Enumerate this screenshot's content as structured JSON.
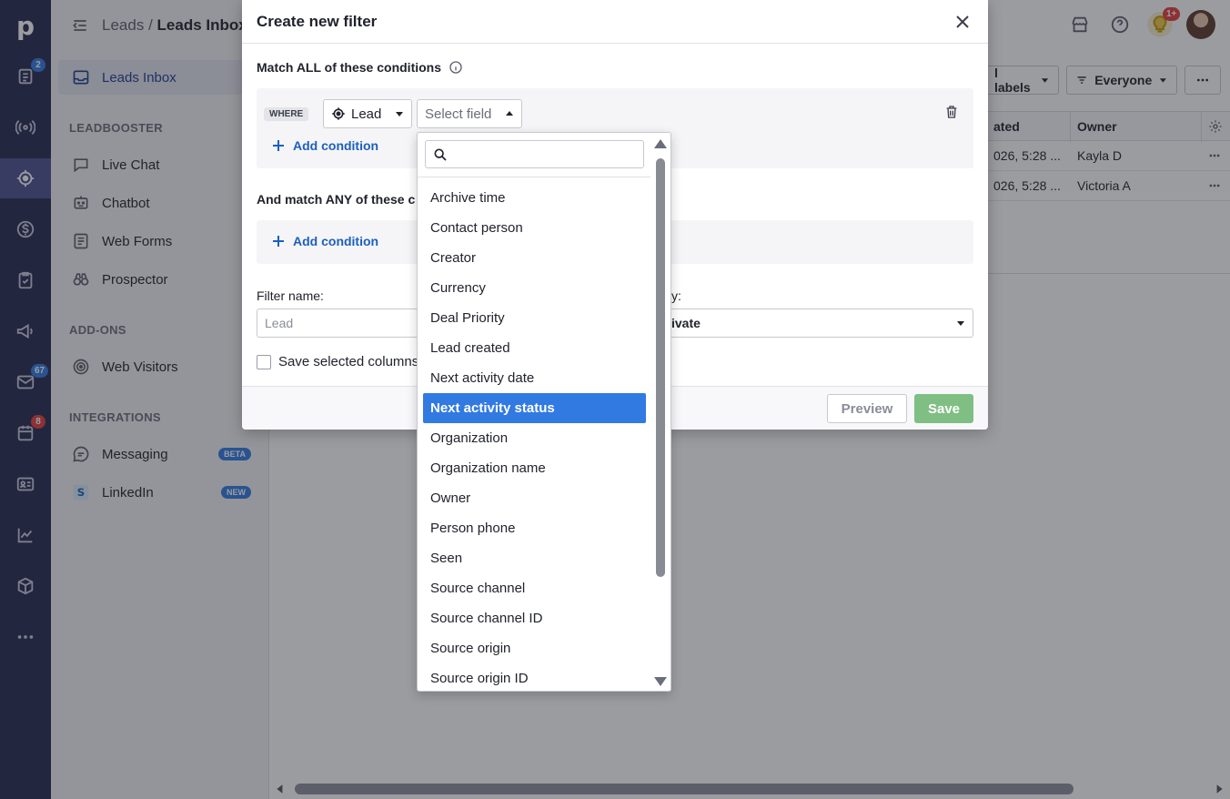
{
  "rail": {
    "logo": "p",
    "badges": {
      "activities": "2",
      "mail": "67",
      "calendar": "8"
    }
  },
  "header": {
    "crumb_parent": "Leads",
    "crumb_sep": "/",
    "crumb_current": "Leads Inbox",
    "notif_badge": "1+"
  },
  "sidenav": {
    "leads_inbox": "Leads Inbox",
    "sections": {
      "leadbooster": "LEADBOOSTER",
      "addons": "ADD-ONS",
      "integrations": "INTEGRATIONS"
    },
    "leadbooster_items": [
      "Live Chat",
      "Chatbot",
      "Web Forms",
      "Prospector"
    ],
    "addon_items": [
      "Web Visitors"
    ],
    "integration_items": [
      {
        "label": "Messaging",
        "pill": "BETA"
      },
      {
        "label": "LinkedIn",
        "pill": "NEW"
      }
    ]
  },
  "toolbar": {
    "labels_filter": "l labels",
    "owner_filter": "Everyone"
  },
  "grid": {
    "columns": [
      "ated",
      "Owner"
    ],
    "rows": [
      {
        "created": "026, 5:28 ...",
        "owner": "Kayla D"
      },
      {
        "created": "026, 5:28 ...",
        "owner": "Victoria A"
      }
    ]
  },
  "modal": {
    "title": "Create new filter",
    "match_all": "Match ALL of these conditions",
    "where": "WHERE",
    "entity": "Lead",
    "field_placeholder": "Select field",
    "add_condition": "Add condition",
    "match_any": "And match ANY of these c",
    "filter_name_label": "Filter name:",
    "filter_name_placeholder": "Lead",
    "visibility_label": "y:",
    "visibility_value": "ivate",
    "save_columns": "Save selected columns",
    "preview": "Preview",
    "save": "Save"
  },
  "dropdown": {
    "search_placeholder": "",
    "selected_index": 7,
    "items": [
      "Archive time",
      "Contact person",
      "Creator",
      "Currency",
      "Deal Priority",
      "Lead created",
      "Next activity date",
      "Next activity status",
      "Organization",
      "Organization name",
      "Owner",
      "Person phone",
      "Seen",
      "Source channel",
      "Source channel ID",
      "Source origin",
      "Source origin ID"
    ]
  },
  "colors": {
    "rail": "#26284f",
    "accent": "#317ae2",
    "save_green": "#7fbf84",
    "badge_red": "#e53c3c",
    "badge_blue": "#317ae2"
  }
}
